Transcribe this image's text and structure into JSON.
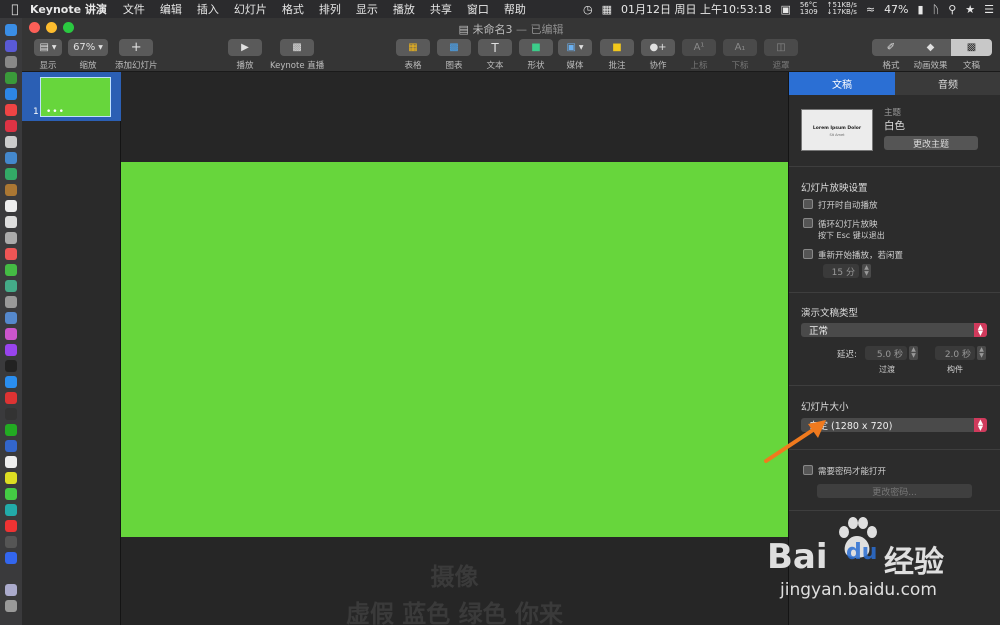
{
  "menubar": {
    "app_name": "Keynote 讲演",
    "menus": [
      "文件",
      "编辑",
      "插入",
      "幻灯片",
      "格式",
      "排列",
      "显示",
      "播放",
      "共享",
      "窗口",
      "帮助"
    ],
    "temp_top": "56°C",
    "temp_bottom": "1309",
    "net_up": "↑51KB/s",
    "net_down": "↓17KB/s",
    "datetime": "01月12日 周日 上午10:53:18",
    "battery": "47%"
  },
  "window": {
    "doc_title": "未命名3",
    "doc_status": "— 已编辑"
  },
  "toolbar": {
    "view_label": "显示",
    "zoom_value": "67%",
    "zoom_label": "缩放",
    "add_slide_label": "添加幻灯片",
    "play_label": "播放",
    "keynote_live_label": "Keynote 直播",
    "table_label": "表格",
    "chart_label": "图表",
    "text_label": "文本",
    "shape_label": "形状",
    "media_label": "媒体",
    "comment_label": "批注",
    "collaborate_label": "协作",
    "superscript_label": "上标",
    "subscript_label": "下标",
    "mask_label": "遮罩",
    "format_label": "格式",
    "animate_label": "动画效果",
    "document_label": "文稿"
  },
  "navigator": {
    "slide_number": "1",
    "slide_color": "#67d63c"
  },
  "canvas": {
    "slide_color": "#67d63c",
    "caption_line1": "摄像",
    "caption_line2": "虚假 蓝色 绿色 你来"
  },
  "inspector": {
    "tab_document": "文稿",
    "tab_audio": "音频",
    "theme_heading": "主题",
    "theme_name": "白色",
    "theme_preview_title": "Lorem Ipsum Dolor",
    "theme_preview_sub": "Sit Amet",
    "change_theme_button": "更改主题",
    "playback_heading": "幻灯片放映设置",
    "auto_play_label": "打开时自动播放",
    "loop_label": "循环幻灯片放映",
    "loop_hint": "按下 Esc 键以退出",
    "restart_label": "重新开始播放，若闲置",
    "idle_value": "15 分",
    "presentation_type_heading": "演示文稿类型",
    "presentation_type_value": "正常",
    "delay_label": "延迟:",
    "transition_value": "5.0 秒",
    "build_value": "2.0 秒",
    "transition_label": "过渡",
    "build_label": "构件",
    "slide_size_heading": "幻灯片大小",
    "slide_size_value": "自定 (1280 x 720)",
    "password_label": "需要密码才能打开",
    "change_password_button": "更改密码..."
  },
  "watermark": {
    "brand": "Bai",
    "brand_du": "du",
    "brand_cn": "经验",
    "url": "jingyan.baidu.com"
  },
  "colors": {
    "accent_blue": "#2b6fd4",
    "select_caret": "#d03a5c",
    "arrow_orange": "#f07a1e"
  }
}
